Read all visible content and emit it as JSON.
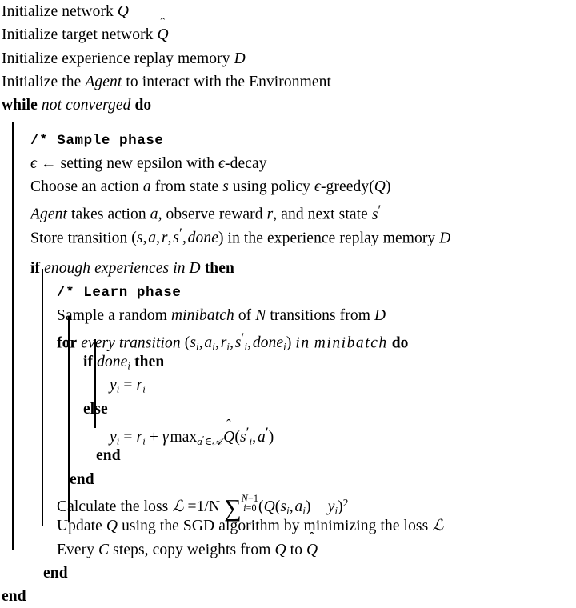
{
  "document": {
    "kind": "algorithm-pseudocode",
    "title": "Deep Q-Network (DQN) training loop",
    "background_color": "#ffffff",
    "text_color": "#000000"
  },
  "symbols": {
    "epsilon": "ϵ",
    "gamma": "γ",
    "leftarrow": "←",
    "sum": "∑",
    "in": "∈",
    "hat": "ˆ",
    "prime": "′",
    "minus": "−",
    "equals": "=",
    "plus": "+"
  },
  "keywords": {
    "while": "while",
    "do": "do",
    "if": "if",
    "then": "then",
    "else": "else",
    "for": "for",
    "end": "end"
  },
  "lines": {
    "l1": {
      "text": "Initialize network",
      "math": "Q"
    },
    "l2": {
      "text": "Initialize target network",
      "math": "Q̂"
    },
    "l3": {
      "text": "Initialize experience replay memory",
      "math": "D"
    },
    "l4": {
      "pre": "Initialize the",
      "em": "Agent",
      "post": "to interact with the Environment"
    },
    "l5": {
      "kw": "while",
      "cond": "not converged",
      "kw2": "do"
    },
    "c1": {
      "comment": "/* Sample phase"
    },
    "l6": {
      "lhs": "ϵ",
      "arrow": "←",
      "text": "setting new epsilon with ϵ-decay"
    },
    "l7": {
      "t1": "Choose an action",
      "v1": "a",
      "t2": "from state",
      "v2": "s",
      "t3": "using policy",
      "v3": "ϵ-greedy(Q)"
    },
    "l8": {
      "em": "Agent",
      "t1": "takes action",
      "v1": "a",
      "t2": ", observe reward",
      "v2": "r",
      "t3": ", and next state",
      "v3": "s′"
    },
    "l9": {
      "t1": "Store transition",
      "tuple": "(s, a, r, s′, done)",
      "t2": "in the experience replay memory",
      "v1": "D"
    },
    "l10": {
      "kw": "if",
      "cond": "enough experiences in",
      "v1": "D",
      "kw2": "then"
    },
    "c2": {
      "comment": "/* Learn phase"
    },
    "l11": {
      "t1": "Sample a random",
      "em": "minibatch",
      "t2": "of",
      "v1": "N",
      "t3": "transitions from",
      "v2": "D"
    },
    "l12": {
      "kw": "for",
      "em1": "every transition",
      "tuple": "(sᵢ, aᵢ, rᵢ, s′ᵢ, doneᵢ)",
      "em2": "in",
      "em3": "minibatch",
      "kw2": "do"
    },
    "l13": {
      "kw": "if",
      "cond": "doneᵢ",
      "kw2": "then"
    },
    "l14": {
      "eq": "yᵢ = rᵢ"
    },
    "l15": {
      "kw": "else"
    },
    "l16": {
      "eq": "yᵢ = rᵢ + γ maxₐ′∈𝒜 Q̂(s′ᵢ, a′)"
    },
    "l17": {
      "kw": "end"
    },
    "l18": {
      "kw": "end"
    },
    "l19": {
      "t1": "Calculate the loss",
      "sym": "ℒ",
      "eq": "=1/N ∑ᵢ₌₀ⁿ⁻¹ (Q(sᵢ, aᵢ) − yᵢ)²"
    },
    "l20": {
      "t1": "Update",
      "v1": "Q",
      "t2": "using the SGD algorithm by minimizing the loss",
      "sym": "ℒ"
    },
    "l21": {
      "t1": "Every",
      "v1": "C",
      "t2": "steps, copy weights from",
      "v2": "Q",
      "t3": "to",
      "v3": "Q̂"
    },
    "l22": {
      "kw": "end"
    },
    "l23": {
      "kw": "end"
    }
  },
  "fragments": {
    "initialize": "Initialize",
    "network": "network",
    "target_network": "target network",
    "experience_replay_memory": "experience replay memory",
    "initialize_the": "Initialize the",
    "agent": "Agent",
    "to_interact": "to interact with the Environment",
    "not_converged": "not converged",
    "sample_phase_comment": "/* Sample phase",
    "learn_phase_comment": "/* Learn phase",
    "setting_new_epsilon": "setting new epsilon with",
    "epsilon_decay": "-decay",
    "choose_an_action": "Choose an action",
    "from_state": "from state",
    "using_policy": "using policy",
    "greedy": "-greedy(",
    "takes_action": "takes action",
    "observe_reward": ", observe reward",
    "and_next_state": ", and next state",
    "store_transition": "Store transition",
    "in_the_experience": "in the experience replay memory",
    "enough_experiences_in": "enough experiences in",
    "sample_a_random": "Sample a random",
    "minibatch": "minibatch",
    "of": "of",
    "transitions_from": "transitions from",
    "every_transition": "every transition",
    "in": "in",
    "done": "done",
    "calculate_the_loss": "Calculate the loss",
    "one_over_n": "=1/N",
    "update": "Update",
    "using_the_sgd": "using the SGD algorithm by minimizing the loss",
    "every": "Every",
    "steps_copy_weights_from": "steps, copy weights from",
    "to": "to"
  }
}
